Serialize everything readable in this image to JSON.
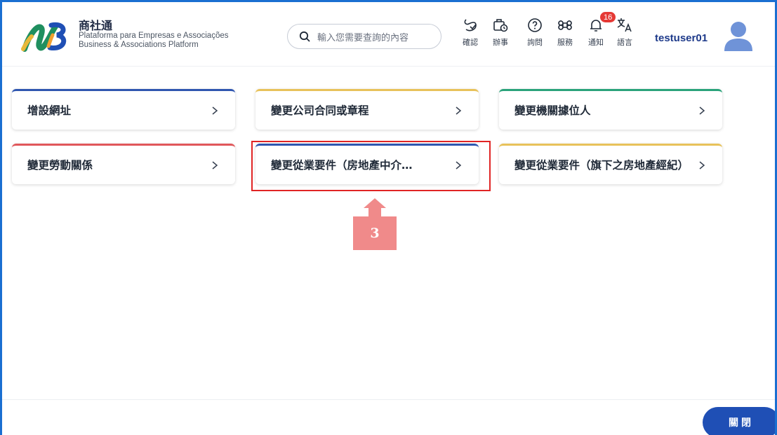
{
  "brand": {
    "name": "商社通",
    "subtitle_line1": "Plataforma para Empresas e Associações",
    "subtitle_line2": "Business & Associations Platform"
  },
  "search": {
    "placeholder": "輸入您需要查詢的內容"
  },
  "nav": [
    {
      "label": "確認",
      "icon": "confirm-icon"
    },
    {
      "label": "辦事",
      "icon": "briefcase-clock-icon"
    },
    {
      "label": "詢問",
      "icon": "question-icon"
    },
    {
      "label": "服務",
      "icon": "command-icon"
    },
    {
      "label": "通知",
      "icon": "bell-icon",
      "badge": "16"
    },
    {
      "label": "語言",
      "icon": "translate-icon"
    }
  ],
  "user": {
    "name": "testuser01"
  },
  "cards": [
    {
      "label": "增設網址",
      "accent": "#2f56b0"
    },
    {
      "label": "變更公司合同或章程",
      "accent": "#e8c25a"
    },
    {
      "label": "變更機關據位人",
      "accent": "#2aa37a"
    },
    {
      "label": "變更勞動關係",
      "accent": "#e0575a"
    },
    {
      "label": "變更從業要件（房地產中介…",
      "accent": "#2f56b0"
    },
    {
      "label": "變更從業要件（旗下之房地產經紀）",
      "accent": "#e8c25a"
    }
  ],
  "annotation": {
    "step": "3"
  },
  "footer": {
    "close_label": "關閉"
  },
  "colors": {
    "primary": "#1f4fb5",
    "badge": "#e53935",
    "annotation": "#f08a8a",
    "highlight": "#e02424"
  }
}
